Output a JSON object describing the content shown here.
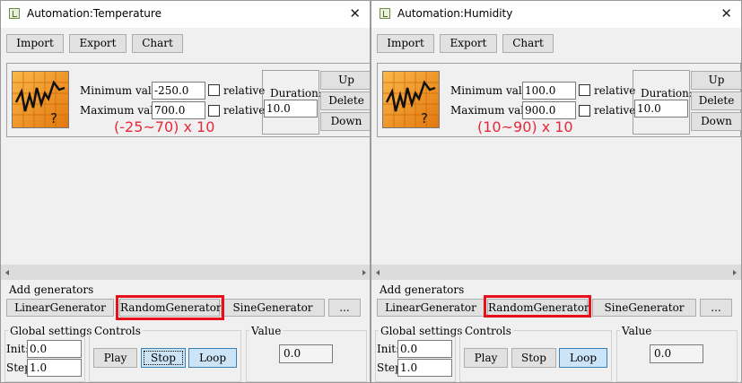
{
  "windows": [
    {
      "id": "temperature",
      "title": "Automation:Temperature",
      "toolbar": {
        "import": "Import",
        "export": "Export",
        "chart": "Chart"
      },
      "generator": {
        "min_label": "Minimum value:",
        "min_value": "-250.0",
        "max_label": "Maximum value:",
        "max_value": "700.0",
        "relative": "relative",
        "duration_label": "Duration:",
        "duration_value": "10.0",
        "up": "Up",
        "delete": "Delete",
        "down": "Down"
      },
      "annotation": "(-25~70) x 10",
      "add_generators": {
        "title": "Add generators",
        "linear": "LinearGenerator",
        "random": "RandomGenerator",
        "sine": "SineGenerator",
        "more": "..."
      },
      "global": {
        "title": "Global settings",
        "init_label": "Init:",
        "init_value": "0.0",
        "step_label": "Step:",
        "step_value": "1.0"
      },
      "controls": {
        "title": "Controls",
        "play": "Play",
        "stop": "Stop",
        "loop": "Loop"
      },
      "value": {
        "title": "Value",
        "value": "0.0"
      }
    },
    {
      "id": "humidity",
      "title": "Automation:Humidity",
      "toolbar": {
        "import": "Import",
        "export": "Export",
        "chart": "Chart"
      },
      "generator": {
        "min_label": "Minimum value:",
        "min_value": "100.0",
        "max_label": "Maximum value:",
        "max_value": "900.0",
        "relative": "relative",
        "duration_label": "Duration:",
        "duration_value": "10.0",
        "up": "Up",
        "delete": "Delete",
        "down": "Down"
      },
      "annotation": "(10~90) x 10",
      "add_generators": {
        "title": "Add generators",
        "linear": "LinearGenerator",
        "random": "RandomGenerator",
        "sine": "SineGenerator",
        "more": "..."
      },
      "global": {
        "title": "Global settings",
        "init_label": "Init:",
        "init_value": "0.0",
        "step_label": "Step:",
        "step_value": "1.0"
      },
      "controls": {
        "title": "Controls",
        "play": "Play",
        "stop": "Stop",
        "loop": "Loop"
      },
      "value": {
        "title": "Value",
        "value": "0.0"
      }
    }
  ],
  "colors": {
    "highlight": "#e8101a",
    "annotation": "#e8283a",
    "icon_orange": "#f39a1d"
  }
}
